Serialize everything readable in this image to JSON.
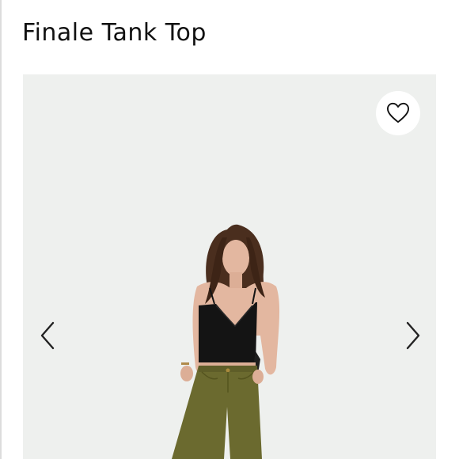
{
  "product": {
    "title": "Finale Tank Top"
  },
  "gallery": {
    "photo_subject": "model-wearing-black-tank-and-olive-pants",
    "background_color": "#eef0ee"
  },
  "icons": {
    "like": "heart-outline-icon",
    "prev": "chevron-left-icon",
    "next": "chevron-right-icon"
  },
  "colors": {
    "text": "#111111",
    "top": "#141414",
    "pants": "#6b6a2f",
    "hair": "#4a2e1e",
    "skin": "#e3b7a0"
  }
}
